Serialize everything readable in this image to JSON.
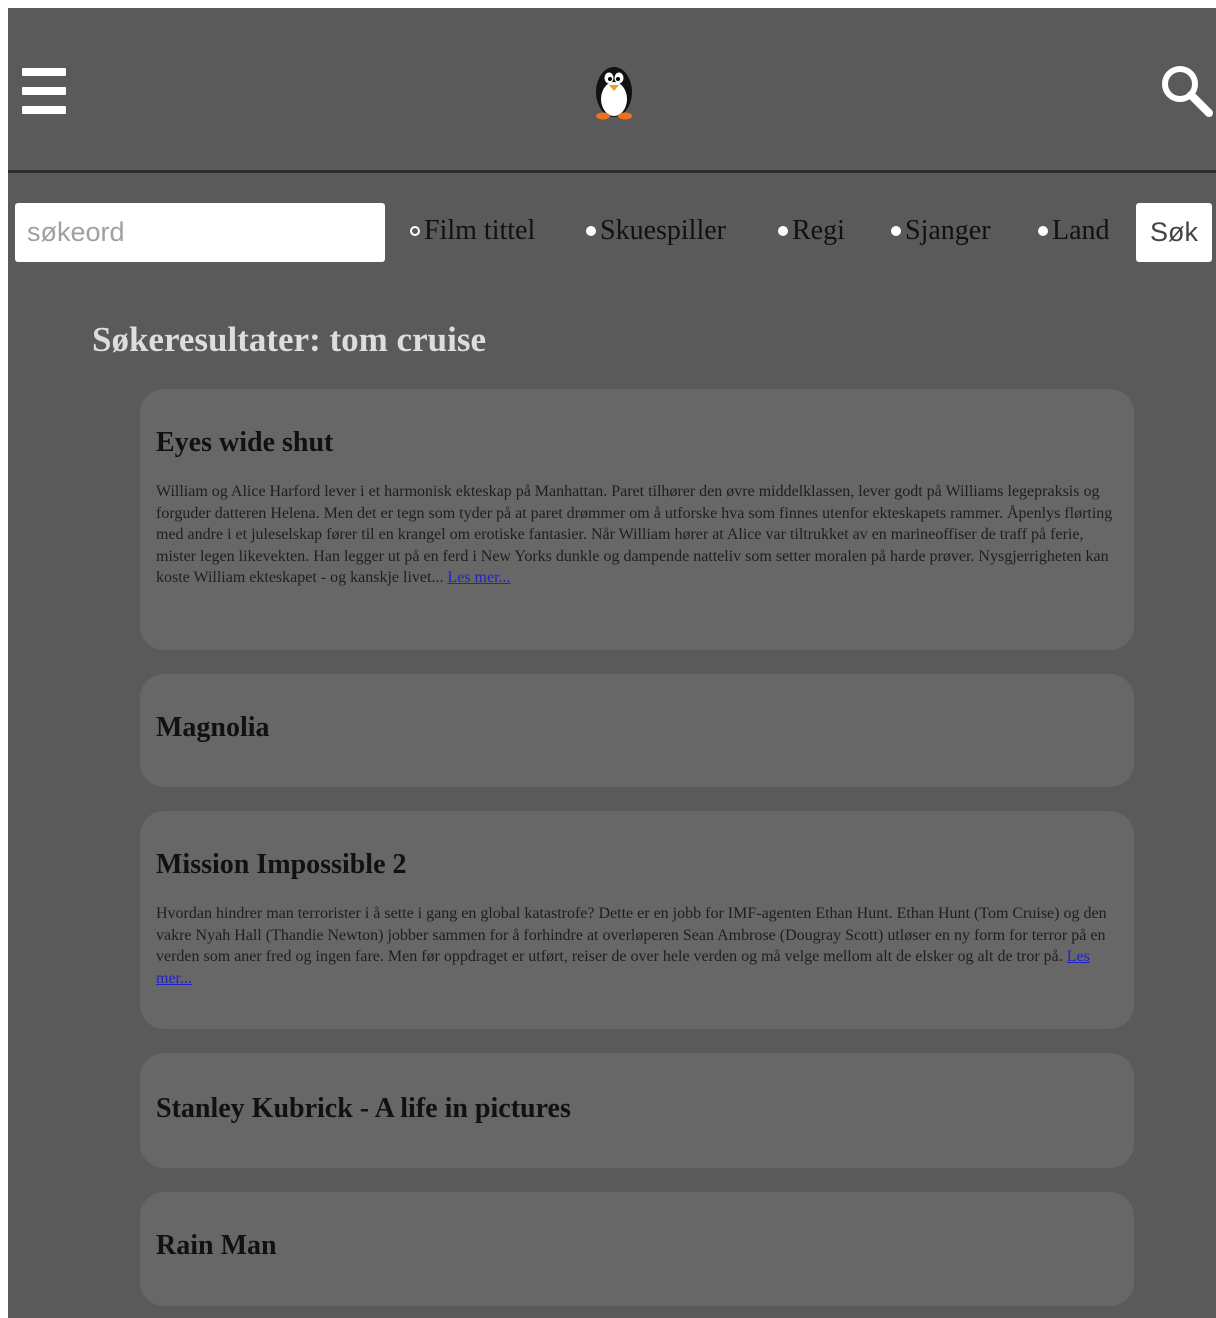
{
  "header": {
    "menu_icon": "hamburger-menu-icon",
    "logo_icon": "penguin-logo-icon",
    "search_icon": "magnifier-icon"
  },
  "search": {
    "placeholder": "søkeord",
    "value": "",
    "options": [
      {
        "label": "Film tittel",
        "checked": false
      },
      {
        "label": "Skuespiller",
        "checked": true
      },
      {
        "label": "Regi",
        "checked": false
      },
      {
        "label": "Sjanger",
        "checked": false
      },
      {
        "label": "Land",
        "checked": false
      }
    ],
    "button_label": "Søk"
  },
  "results": {
    "heading": "Søkeresultater: tom cruise",
    "more_label": "Les mer...",
    "items": [
      {
        "title": "Eyes wide shut",
        "description": "William og Alice Harford lever i et harmonisk ekteskap på Manhattan. Paret tilhører den øvre middelklassen, lever godt på Williams legepraksis og forguder datteren Helena. Men det er tegn som tyder på at paret drømmer om å utforske hva som finnes utenfor ekteskapets rammer. Åpenlys flørting med andre i et juleselskap fører til en krangel om erotiske fantasier. Når William hører at Alice var tiltrukket av en marineoffiser de traff på ferie, mister legen likevekten. Han legger ut på en ferd i New Yorks dunkle og dampende natteliv som setter moralen på harde prøver. Nysgjerrigheten kan koste William ekteskapet - og kanskje livet..."
      },
      {
        "title": "Magnolia",
        "description": ""
      },
      {
        "title": "Mission Impossible 2",
        "description": "Hvordan hindrer man terrorister i å sette i gang en global katastrofe? Dette er en jobb for IMF-agenten Ethan Hunt. Ethan Hunt (Tom Cruise) og den vakre Nyah Hall (Thandie Newton) jobber sammen for å forhindre at overløperen Sean Ambrose (Dougray Scott) utløser en ny form for terror på en verden som aner fred og ingen fare. Men før oppdraget er utført, reiser de over hele verden og må velge mellom alt de elsker og alt de tror på."
      },
      {
        "title": "Stanley Kubrick - A life in pictures",
        "description": ""
      },
      {
        "title": "Rain Man",
        "description": ""
      }
    ]
  }
}
